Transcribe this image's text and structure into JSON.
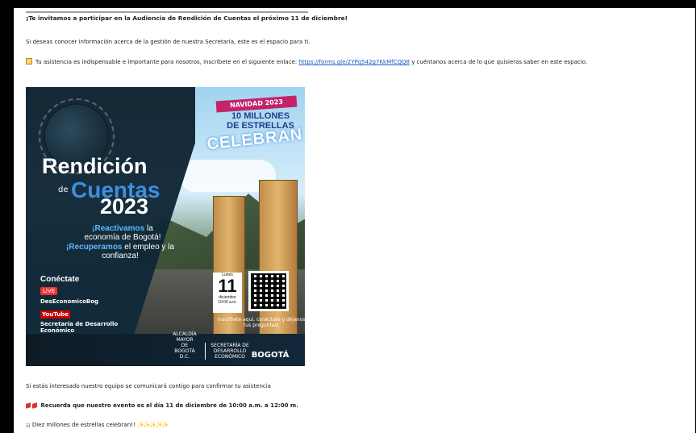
{
  "email": {
    "header": "¡Te invitamos a participar en la Audiencia de Rendición de Cuentas el próximo 11 de diciembre!",
    "intro": "Si deseas conocer información acerca de la gestión de nuestra Secretaría, este es el espacio para ti.",
    "register_prefix": "Tu asistencia es indispensable e importante para nosotros, inscríbete en el siguiente enlace:",
    "register_link": "https://forms.gle/2YPq542g7KkMfCQQ8",
    "register_suffix": "y cuéntanos acerca de lo que quisieras saber en este espacio.",
    "confirm_text": "Si estás interesado nuestro equipo se comunicará contigo para confirmar tu asistencia",
    "reminder_text": "Recuerda que nuestro evento es el día 11 de diciembre de 10:00 a.m. a 12:00 m.",
    "closing_text": "¡¡ Diez millones de estrellas celebran!!",
    "closing_emojis": "✨✨✨✨✨"
  },
  "poster": {
    "navidad_tag": "NAVIDAD 2023",
    "millones": "10 MILLONES",
    "estrellas": "DE ESTRELLAS",
    "celebran": "CELEBRAN",
    "title_line1": "Rendición",
    "title_de": "de",
    "title_line2": "Cuentas",
    "title_year": "2023",
    "react_bold": "¡Reactivamos",
    "react_rest": "la economía de Bogotá!",
    "recup_bold": "¡Recuperamos",
    "recup_rest": "el empleo y la confianza!",
    "conectate": "Conéctate",
    "live": "LIVE",
    "fb_handle": "DesEconomicoBog",
    "yt_label": "YouTube",
    "yt_channel": "Secretaría de Desarrollo Económico",
    "date_small": "Lunes",
    "date_day": "11",
    "date_month": "diciembre",
    "date_time": "10:00 a.m.",
    "inscribe": "Inscríbete aquí, conéctate y déjanos tus preguntas!",
    "logo_left": "ALCALDÍA MAYOR DE BOGOTÁ D.C.",
    "logo_sde": "SECRETARÍA DE DESARROLLO ECONÓMICO",
    "logo_bogota": "BOGOTÁ"
  },
  "colors": {
    "link": "#1a55c6",
    "accent_blue": "#3b8fe0",
    "navidad_pink": "#c3236a"
  }
}
